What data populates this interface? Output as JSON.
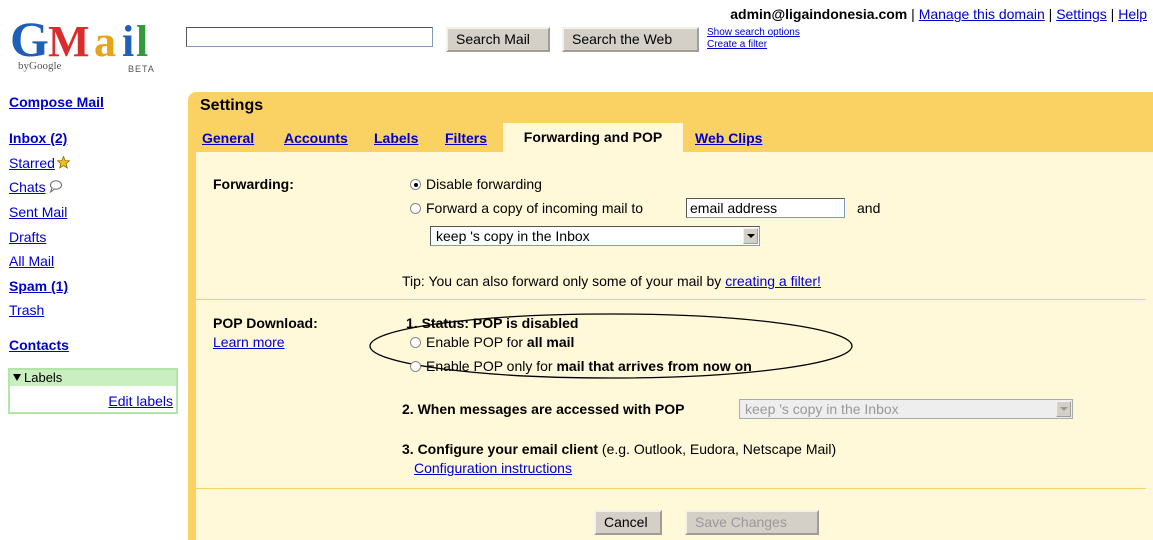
{
  "brand": {
    "logo_text": "Gmail",
    "by_google": "byGoogle",
    "beta": "BETA"
  },
  "search": {
    "input_value": "",
    "search_mail": "Search Mail",
    "search_web": "Search the Web",
    "show_options": "Show search options",
    "create_filter": "Create a filter"
  },
  "userbar": {
    "email": "admin@ligaindonesia.com",
    "sep": "|",
    "manage_domain": "Manage this domain",
    "settings": "Settings",
    "help": "Help"
  },
  "nav": {
    "compose": "Compose Mail",
    "inbox": "Inbox (2)",
    "starred": "Starred",
    "chats": "Chats",
    "sent": "Sent Mail",
    "drafts": "Drafts",
    "all_mail": "All Mail",
    "spam": "Spam (1)",
    "trash": "Trash",
    "contacts": "Contacts",
    "labels_header": "Labels",
    "edit_labels": "Edit labels"
  },
  "settings": {
    "title": "Settings",
    "tabs": [
      {
        "label": "General"
      },
      {
        "label": "Accounts"
      },
      {
        "label": "Labels"
      },
      {
        "label": "Filters"
      },
      {
        "label": "Forwarding and POP"
      },
      {
        "label": "Web Clips"
      }
    ],
    "active_tab": "Forwarding and POP",
    "forwarding": {
      "label": "Forwarding:",
      "disable": "Disable forwarding",
      "forward_copy": "Forward a copy of incoming mail to",
      "email_value": "email address",
      "and": "and",
      "keep_select": "keep 's copy in the Inbox",
      "tip_prefix": "Tip: You can also forward only some of your mail by ",
      "tip_link": "creating a filter!"
    },
    "pop": {
      "label": "POP Download:",
      "learn_more": "Learn more",
      "status": "1. Status: POP is disabled",
      "enable_all_prefix": "Enable POP for ",
      "enable_all_bold": "all mail",
      "enable_now_prefix": "Enable POP only for ",
      "enable_now_bold": "mail that arrives from now on",
      "when_accessed": "2. When messages are accessed with POP",
      "when_select": "keep 's copy in the Inbox",
      "configure_bold": "3. Configure your email client",
      "configure_rest": " (e.g. Outlook, Eudora, Netscape Mail)",
      "config_link": "Configuration instructions"
    },
    "buttons": {
      "cancel": "Cancel",
      "save": "Save Changes"
    }
  },
  "colors": {
    "gold": "#fad163",
    "cream": "#fff8d9",
    "link": "#0000cc"
  }
}
